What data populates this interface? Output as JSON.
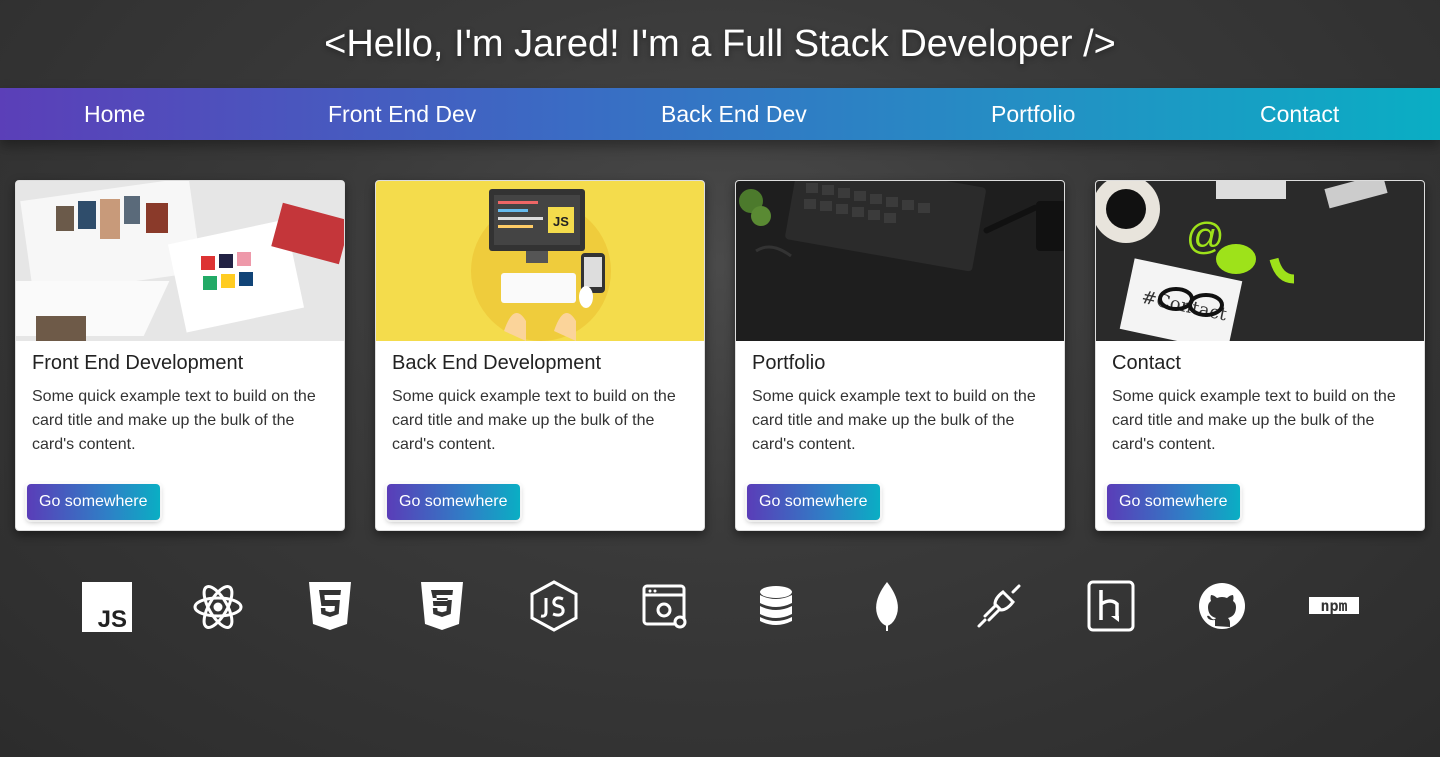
{
  "header": {
    "title": "<Hello, I'm Jared! I'm a Full Stack Developer />"
  },
  "nav": {
    "items": [
      {
        "label": "Home"
      },
      {
        "label": "Front End Dev"
      },
      {
        "label": "Back End Dev"
      },
      {
        "label": "Portfolio"
      },
      {
        "label": "Contact"
      }
    ]
  },
  "cards": [
    {
      "title": "Front End Development",
      "text": "Some quick example text to build on the card title and make up the bulk of the card's content.",
      "button": "Go somewhere"
    },
    {
      "title": "Back End Development",
      "text": "Some quick example text to build on the card title and make up the bulk of the card's content.",
      "button": "Go somewhere"
    },
    {
      "title": "Portfolio",
      "text": "Some quick example text to build on the card title and make up the bulk of the card's content.",
      "button": "Go somewhere"
    },
    {
      "title": "Contact",
      "text": "Some quick example text to build on the card title and make up the bulk of the card's content.",
      "button": "Go somewhere"
    }
  ],
  "card_images": {
    "front_end_badge": "JS",
    "contact_note": "#Contact"
  },
  "tech_icons": {
    "js_label": "JS",
    "npm_label": "npm",
    "names": [
      "javascript-icon",
      "react-icon",
      "html5-icon",
      "css3-icon",
      "nodejs-icon",
      "api-icon",
      "database-icon",
      "mongodb-icon",
      "plug-icon",
      "heroku-icon",
      "github-icon",
      "npm-icon"
    ]
  },
  "colors": {
    "nav_gradient_start": "#5b3fb8",
    "nav_gradient_end": "#0aaec4",
    "page_background": "#333333"
  }
}
